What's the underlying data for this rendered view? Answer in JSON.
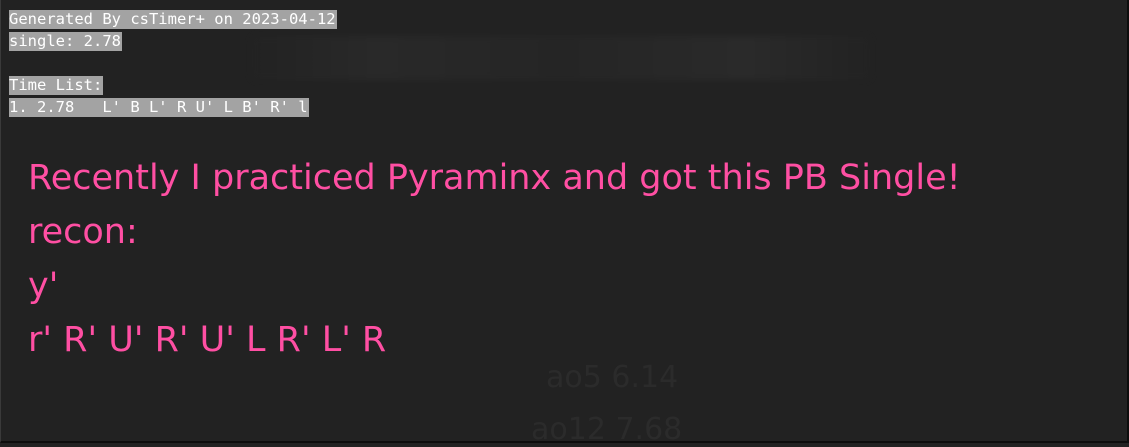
{
  "export_text": {
    "header": "Generated By csTimer+ on 2023-04-12",
    "single": "single: 2.78",
    "list_title": "Time List:",
    "list_item": "1. 2.78   L' B L' R U' L B' R' l"
  },
  "caption": {
    "line1": "Recently I practiced Pyraminx and got this PB Single!",
    "line2": "recon:",
    "line3": "y'",
    "line4": "r' R' U' R' U' L R' L' R"
  },
  "colors": {
    "background": "#222222",
    "highlight": "#a3a3a3",
    "caption_text": "#ff4fa3"
  }
}
